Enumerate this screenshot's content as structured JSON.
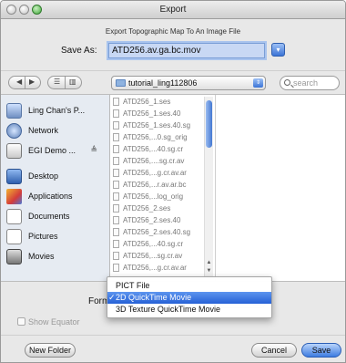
{
  "window": {
    "title": "Export"
  },
  "header": {
    "description": "Export Topographic Map To An Image File",
    "save_as_label": "Save As:",
    "save_as_value": "ATD256.av.ga.bc.mov"
  },
  "toolbar": {
    "location": "tutorial_ling112806",
    "search_placeholder": "search"
  },
  "sidebar": {
    "items": [
      {
        "label": "Ling Chan's P...",
        "icon": "computer-icon"
      },
      {
        "label": "Network",
        "icon": "network-icon"
      },
      {
        "label": "EGI Demo ...",
        "icon": "disk-icon",
        "eject": "≜"
      },
      {
        "label": "Desktop",
        "icon": "desktop-icon"
      },
      {
        "label": "Applications",
        "icon": "applications-icon"
      },
      {
        "label": "Documents",
        "icon": "documents-icon"
      },
      {
        "label": "Pictures",
        "icon": "pictures-icon"
      },
      {
        "label": "Movies",
        "icon": "movies-icon"
      }
    ]
  },
  "files": [
    "ATD256_1.ses",
    "ATD256_1.ses.40",
    "ATD256_1.ses.40.sg",
    "ATD256,...0.sg_orig",
    "ATD256,...40.sg.cr",
    "ATD256,....sg.cr.av",
    "ATD256,...g.cr.av.ar",
    "ATD256,...r.av.ar.bc",
    "ATD256,...log_orig",
    "ATD256_2.ses",
    "ATD256_2.ses.40",
    "ATD256_2.ses.40.sg",
    "ATD256,...40.sg.cr",
    "ATD256,...sg.cr.av",
    "ATD256,...g.cr.av.ar"
  ],
  "format": {
    "label": "Format:",
    "options": [
      {
        "label": "PICT File",
        "selected": false
      },
      {
        "label": "2D QuickTime Movie",
        "selected": true
      },
      {
        "label": "3D Texture QuickTime Movie",
        "selected": false
      }
    ]
  },
  "options": {
    "show_equator_label": "Show Equator"
  },
  "footer": {
    "new_folder_label": "New Folder",
    "cancel_label": "Cancel",
    "save_label": "Save"
  }
}
